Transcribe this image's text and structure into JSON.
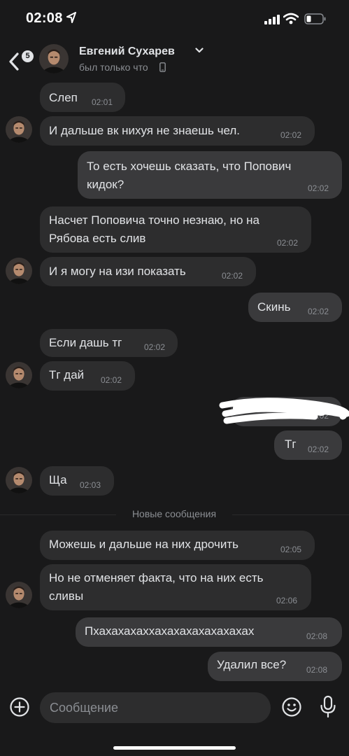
{
  "status_bar": {
    "time": "02:08"
  },
  "header": {
    "back_badge": "5",
    "name": "Евгений Сухарев",
    "status": "был только что"
  },
  "messages": [
    {
      "text": "Слеп",
      "time": "02:01"
    },
    {
      "text": "И дальше вк нихуя не знаешь чел.",
      "time": "02:02"
    },
    {
      "line1": "То есть хочешь сказать, что Попович",
      "line2": "кидок?",
      "time": "02:02"
    },
    {
      "line1": "Насчет Поповича точно незнаю, но на",
      "line2": "Рябова есть слив",
      "time": "02:02"
    },
    {
      "text": "И я могу на изи показать",
      "time": "02:02"
    },
    {
      "text": "Скинь",
      "time": "02:02"
    },
    {
      "text": "Если дашь тг",
      "time": "02:02"
    },
    {
      "text": "Тг дай",
      "time": "02:02"
    },
    {
      "text": "",
      "time": "02:02"
    },
    {
      "text": "Тг",
      "time": "02:02"
    },
    {
      "text": "Ща",
      "time": "02:03"
    },
    {
      "text": "Можешь и дальше на них дрочить",
      "time": "02:05"
    },
    {
      "line1": "Но не отменяет факта, что на них есть",
      "line2": "сливы",
      "time": "02:06"
    },
    {
      "text": "Пхахахахаххахахахахахахахах",
      "time": "02:08"
    },
    {
      "text": "Удалил все?",
      "time": "02:08"
    }
  ],
  "divider": {
    "label": "Новые сообщения"
  },
  "composer": {
    "placeholder": "Сообщение"
  },
  "icons": {
    "status": [
      "location-arrow-icon",
      "signal-icon",
      "wifi-icon",
      "battery-icon"
    ],
    "header": [
      "back-icon",
      "chevron-down-icon",
      "phone-icon"
    ],
    "composer": [
      "plus-icon",
      "emoji-icon",
      "mic-icon"
    ]
  },
  "colors": {
    "background": "#19191a",
    "incoming_bubble": "#2d2d2e",
    "outgoing_bubble": "#3a3a3c",
    "text": "#e1e3e6",
    "muted": "#8b8e93"
  }
}
